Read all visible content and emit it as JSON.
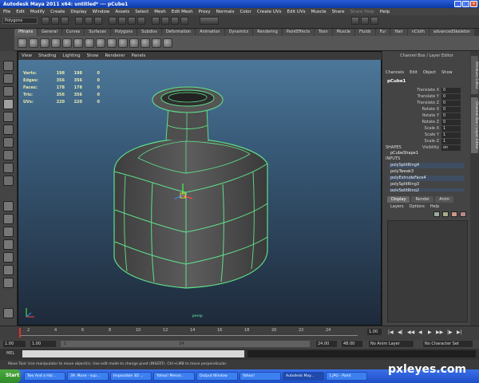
{
  "window": {
    "title": "Autodesk Maya 2011 x64: untitled*  ---  pCube1"
  },
  "menubar": [
    "File",
    "Edit",
    "Modify",
    "Create",
    "Display",
    "Window",
    "Assets",
    "Select",
    "Mesh",
    "Edit Mesh",
    "Proxy",
    "Normals",
    "Color",
    "Create UVs",
    "Edit UVs",
    "Muscle",
    "Share",
    "Share Help",
    "Help"
  ],
  "status": {
    "mode": "Polygons"
  },
  "shelf_tabs": [
    {
      "label": "Pfinans",
      "active": true
    },
    {
      "label": "General"
    },
    {
      "label": "Curves"
    },
    {
      "label": "Surfaces"
    },
    {
      "label": "Polygons"
    },
    {
      "label": "Subdivs"
    },
    {
      "label": "Deformation"
    },
    {
      "label": "Animation"
    },
    {
      "label": "Dynamics"
    },
    {
      "label": "Rendering"
    },
    {
      "label": "PaintEffects"
    },
    {
      "label": "Toon"
    },
    {
      "label": "Muscle"
    },
    {
      "label": "Fluids"
    },
    {
      "label": "Fur"
    },
    {
      "label": "Hair"
    },
    {
      "label": "nCloth"
    },
    {
      "label": "advancedSkeleton"
    }
  ],
  "viewport": {
    "menu": [
      "View",
      "Shading",
      "Lighting",
      "Show",
      "Renderer",
      "Panels"
    ],
    "hud": [
      {
        "label": "Verts:",
        "a": "198",
        "b": "198",
        "c": "0"
      },
      {
        "label": "Edges:",
        "a": "356",
        "b": "356",
        "c": "0"
      },
      {
        "label": "Faces:",
        "a": "178",
        "b": "178",
        "c": "0"
      },
      {
        "label": "Tris:",
        "a": "356",
        "b": "356",
        "c": "0"
      },
      {
        "label": "UVs:",
        "a": "220",
        "b": "220",
        "c": "0"
      }
    ],
    "camera": "persp",
    "wire_color": "#5fe08a",
    "mesh_color": "#5a5a5a"
  },
  "channel_box": {
    "title": "Channel Box / Layer Editor",
    "menu": [
      "Channels",
      "Edit",
      "Object",
      "Show"
    ],
    "object": "pCube1",
    "attributes": [
      {
        "name": "Translate X",
        "value": "0"
      },
      {
        "name": "Translate Y",
        "value": "0"
      },
      {
        "name": "Translate Z",
        "value": "0"
      },
      {
        "name": "Rotate X",
        "value": "0"
      },
      {
        "name": "Rotate Y",
        "value": "0"
      },
      {
        "name": "Rotate Z",
        "value": "0"
      },
      {
        "name": "Scale X",
        "value": "1"
      },
      {
        "name": "Scale Y",
        "value": "1"
      },
      {
        "name": "Scale Z",
        "value": "1"
      },
      {
        "name": "Visibility",
        "value": "on"
      }
    ],
    "shapes_label": "SHAPES",
    "shapes": [
      "pCubeShape1"
    ],
    "inputs_label": "INPUTS",
    "inputs": [
      "polySplitRing4",
      "polyTweak3",
      "polyExtrudeFace4",
      "polySplitRing3",
      "polySplitRing2"
    ]
  },
  "layer_editor": {
    "tabs": [
      {
        "label": "Display",
        "active": true
      },
      {
        "label": "Render"
      },
      {
        "label": "Anim"
      }
    ],
    "menu": [
      "Layers",
      "Options",
      "Help"
    ]
  },
  "side_tabs": [
    "Attribute Editor",
    "Channel Box / Layer Editor"
  ],
  "timeline": {
    "ticks": [
      "2",
      "4",
      "6",
      "8",
      "10",
      "12",
      "14",
      "16",
      "18",
      "20",
      "22",
      "24"
    ],
    "current_frame": "1.00"
  },
  "range": {
    "start": "1.00",
    "inner_start": "1.00",
    "range_start_frame": "1",
    "range_end_frame": "24",
    "end": "24.00",
    "end_total": "48.00",
    "anim_layer": "No Anim Layer",
    "character": "No Character Set"
  },
  "cmdline": {
    "label": "MEL"
  },
  "helpline": {
    "text": "Move Tool: Use manipulator to move object(s). Use edit mode to change pivot (INSERT). Ctrl+LMB to move perpendicular."
  },
  "taskbar": {
    "start": "Start",
    "tasks": [
      {
        "label": "Two And a Hal..."
      },
      {
        "label": "39. Muse - sup..."
      },
      {
        "label": "Impossible 3D ..."
      },
      {
        "label": "Yahoo! Messe..."
      },
      {
        "label": "Output Window"
      },
      {
        "label": "Yahoo!"
      },
      {
        "label": "Autodesk May...",
        "active": true
      },
      {
        "label": "1.JPG - Paint"
      }
    ]
  },
  "watermark": "pxleyes.com"
}
